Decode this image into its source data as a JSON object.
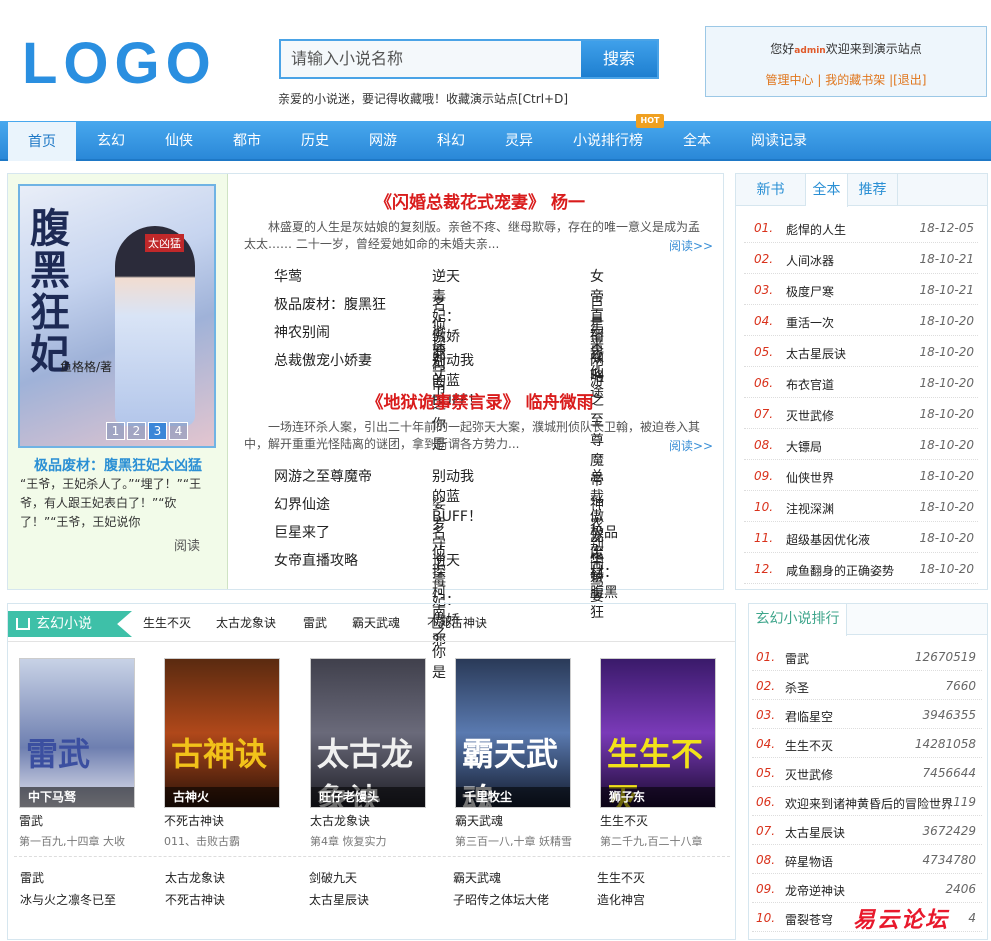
{
  "header": {
    "logo": "LOGO",
    "search_placeholder": "请输入小说名称",
    "search_button": "搜索",
    "favorite_tip": "亲爱的小说迷，要记得收藏哦！收藏演示站点[Ctrl+D]",
    "user": {
      "greeting_pre": "您好",
      "username": "admin",
      "greeting_post": "欢迎来到演示站点",
      "manage": "管理中心",
      "bookshelf": "我的藏书架",
      "logout": "[退出]",
      "sep": "|"
    }
  },
  "nav": {
    "items": [
      "首页",
      "玄幻",
      "仙侠",
      "都市",
      "历史",
      "网游",
      "科幻",
      "灵异",
      "小说排行榜",
      "全本",
      "阅读记录"
    ],
    "hot_badge": "HOT"
  },
  "featured": {
    "cover": {
      "title": "腹黑狂妃",
      "sub": "太凶猛",
      "author": "鱼格格/著",
      "pages": [
        "1",
        "2",
        "3",
        "4"
      ]
    },
    "left_title": "极品废材：腹黑狂妃太凶猛",
    "left_desc": "“王爷，王妃杀人了。”“埋了！”“王爷，有人跟王妃表白了！”“砍了！”“王爷，王妃说你",
    "left_read": "阅读",
    "books": [
      {
        "title": "《闪婚总裁花式宠妻》 杨一",
        "desc": "林盛夏的人生是灰姑娘的复刻版。亲爸不疼、继母欺辱，存在的唯一意义是成为孟太太…… 二十一岁，曾经爱她如命的未婚夫亲...",
        "read_more": "阅读>>",
        "links": [
          "华莺",
          "逆天毒妃：傲娇邪",
          "女帝直播攻略",
          "极品废材：腹黑狂",
          "名侦探柯南之你是",
          "巨星来了",
          "神农别闹",
          "娑罗守卫",
          "幻界仙途",
          "总裁傲宠小娇妻",
          "别动我的蓝BUFF！",
          "网游之至尊魔帝"
        ]
      },
      {
        "title": "《地狱诡事禁言录》 临舟微雨",
        "desc": "一场连环杀人案，引出二十年前的一起弥天大案，濮城刑侦队长卫翰，被迫卷入其中，解开重重光怪陆离的谜团，拿到所谓各方势力...",
        "read_more": "阅读>>",
        "links": [
          "网游之至尊魔帝",
          "别动我的蓝BUFF！",
          "总裁傲宠小娇妻",
          "幻界仙途",
          "娑罗守卫",
          "神农别闹",
          "巨星来了",
          "名侦探柯南之你是",
          "极品废材：腹黑狂",
          "女帝直播攻略",
          "逆天毒妃：傲娇邪",
          "华莺"
        ]
      }
    ]
  },
  "right_tabs": {
    "tabs": [
      "新书",
      "全本",
      "推荐"
    ],
    "rows": [
      {
        "num": "01.",
        "name": "彪悍的人生",
        "date": "18-12-05"
      },
      {
        "num": "02.",
        "name": "人间冰器",
        "date": "18-10-21"
      },
      {
        "num": "03.",
        "name": "极度尸寒",
        "date": "18-10-21"
      },
      {
        "num": "04.",
        "name": "重活一次",
        "date": "18-10-20"
      },
      {
        "num": "05.",
        "name": "太古星辰诀",
        "date": "18-10-20"
      },
      {
        "num": "06.",
        "name": "布衣官道",
        "date": "18-10-20"
      },
      {
        "num": "07.",
        "name": "灭世武修",
        "date": "18-10-20"
      },
      {
        "num": "08.",
        "name": "大镖局",
        "date": "18-10-20"
      },
      {
        "num": "09.",
        "name": "仙侠世界",
        "date": "18-10-20"
      },
      {
        "num": "10.",
        "name": "注视深渊",
        "date": "18-10-20"
      },
      {
        "num": "11.",
        "name": "超级基因优化液",
        "date": "18-10-20"
      },
      {
        "num": "12.",
        "name": "咸鱼翻身的正确姿势",
        "date": "18-10-20"
      }
    ]
  },
  "xuanhuan": {
    "heading": "玄幻小说",
    "tags": [
      "生生不灭",
      "太古龙象诀",
      "雷武",
      "霸天武魂",
      "不死古神诀"
    ],
    "books": [
      {
        "cover_title": "雷武",
        "author": "中下马驽",
        "name": "雷武",
        "chapter": "第一百九,十四章 大收",
        "color": "#3b4fa0",
        "bg": "linear-gradient(#c8d2e6,#6e7fb0 60%,#e6e6f0)"
      },
      {
        "cover_title": "古神诀",
        "author": "古神火",
        "name": "不死古神诀",
        "chapter": "011、击败古霸",
        "color": "#f2c21a",
        "bg": "linear-gradient(#5a2a10,#b0481a 50%,#2a1208)"
      },
      {
        "cover_title": "太古龙象诀",
        "author": "旺仔老馒头",
        "name": "太古龙象诀",
        "chapter": "第4章 恢复实力",
        "color": "#f0f0f0",
        "bg": "linear-gradient(#40404c,#6a6a7a 50%,#1e1e26)"
      },
      {
        "cover_title": "霸天武魂",
        "author": "千里牧尘",
        "name": "霸天武魂",
        "chapter": "第三百一八,十章 妖精雪",
        "color": "#ffffff",
        "bg": "linear-gradient(#2a3a58,#5a7ab0 50%,#121a2c)"
      },
      {
        "cover_title": "生生不灭",
        "author": "狮子东",
        "name": "生生不灭",
        "chapter": "第二千九,百二十八章",
        "color": "#f2e21a",
        "bg": "linear-gradient(#3a1a6a,#7a3ab8 50%,#1a0a30)"
      }
    ],
    "list_col": [
      [
        "雷武",
        "冰与火之凛冬已至"
      ],
      [
        "太古龙象诀",
        "不死古神诀"
      ],
      [
        "剑破九天",
        "太古星辰诀"
      ],
      [
        "霸天武魂",
        "子昭传之体坛大佬"
      ],
      [
        "生生不灭",
        "造化神宫"
      ]
    ]
  },
  "ranking": {
    "title": "玄幻小说排行",
    "rows": [
      {
        "num": "01.",
        "name": "雷武",
        "count": "12670519"
      },
      {
        "num": "02.",
        "name": "杀圣",
        "count": "7660"
      },
      {
        "num": "03.",
        "name": "君临星空",
        "count": "3946355"
      },
      {
        "num": "04.",
        "name": "生生不灭",
        "count": "14281058"
      },
      {
        "num": "05.",
        "name": "灭世武修",
        "count": "7456644"
      },
      {
        "num": "06.",
        "name": "欢迎来到诸神黄昏后的冒险世界",
        "count": "119"
      },
      {
        "num": "07.",
        "name": "太古星辰诀",
        "count": "3672429"
      },
      {
        "num": "08.",
        "name": "碎星物语",
        "count": "4734780"
      },
      {
        "num": "09.",
        "name": "龙帝逆神诀",
        "count": "2406"
      },
      {
        "num": "10.",
        "name": "雷裂苍穹",
        "count": "4"
      }
    ]
  },
  "watermark": "易云论坛"
}
